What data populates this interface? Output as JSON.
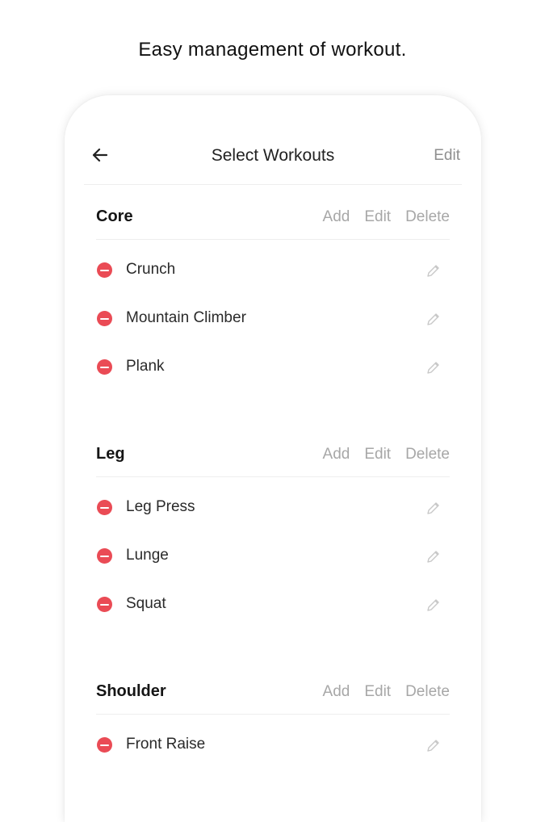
{
  "tagline": "Easy management of workout.",
  "nav": {
    "title": "Select Workouts",
    "edit_label": "Edit",
    "back_icon": "arrow-left-icon"
  },
  "colors": {
    "remove_red": "#ea4b55",
    "muted_text": "#a7a7a7",
    "divider": "#eeeeee"
  },
  "sections": [
    {
      "title": "Core",
      "actions": [
        "Add",
        "Edit",
        "Delete"
      ],
      "items": [
        "Crunch",
        "Mountain Climber",
        "Plank"
      ]
    },
    {
      "title": "Leg",
      "actions": [
        "Add",
        "Edit",
        "Delete"
      ],
      "items": [
        "Leg Press",
        "Lunge",
        "Squat"
      ]
    },
    {
      "title": "Shoulder",
      "actions": [
        "Add",
        "Edit",
        "Delete"
      ],
      "items": [
        "Front Raise"
      ]
    }
  ]
}
